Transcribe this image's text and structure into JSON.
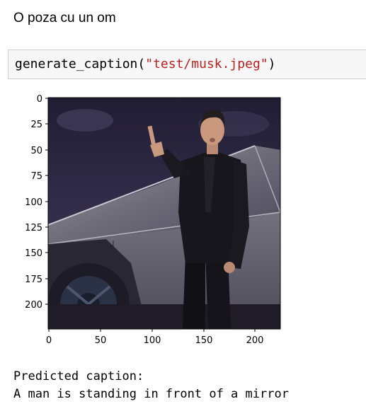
{
  "markdown_cell": {
    "text": "O poza cu un om"
  },
  "code_cell": {
    "function": "generate_caption",
    "open": "(",
    "argument": "\"test/musk.jpeg\"",
    "close": ")",
    "colors": {
      "string": "#ba2121",
      "background": "#f7f7f7",
      "border": "#cfcfcf"
    }
  },
  "image_plot": {
    "x_ticks": [
      "0",
      "50",
      "100",
      "150",
      "200"
    ],
    "y_ticks": [
      "0",
      "25",
      "50",
      "75",
      "100",
      "125",
      "150",
      "175",
      "200"
    ]
  },
  "output": {
    "label": "Predicted caption:",
    "caption": "A man is standing in front of a mirror"
  }
}
